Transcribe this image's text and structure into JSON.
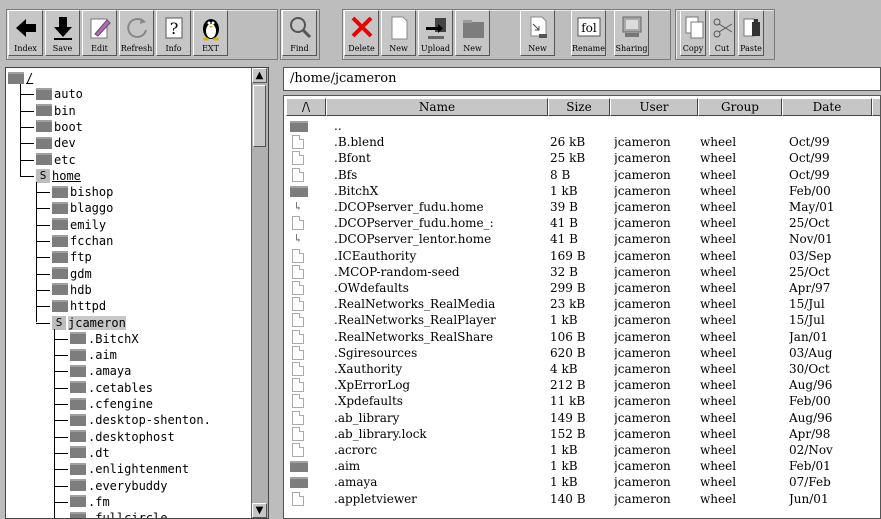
{
  "toolbar": {
    "buttons": [
      {
        "label": "Index"
      },
      {
        "label": "Save"
      },
      {
        "label": "Edit"
      },
      {
        "label": "Refresh"
      },
      {
        "label": "Info"
      },
      {
        "label": "EXT"
      },
      {
        "label": "Find"
      },
      {
        "label": "Delete"
      },
      {
        "label": "New"
      },
      {
        "label": "Upload"
      },
      {
        "label": "New"
      },
      {
        "label": "New"
      },
      {
        "label": "Rename"
      },
      {
        "label": "Sharing"
      },
      {
        "label": "Copy"
      },
      {
        "label": "Cut"
      },
      {
        "label": "Paste"
      }
    ]
  },
  "tree": {
    "root": "/",
    "items": [
      {
        "label": "auto"
      },
      {
        "label": "bin"
      },
      {
        "label": "boot"
      },
      {
        "label": "dev"
      },
      {
        "label": "etc"
      },
      {
        "label": "home",
        "badge": "S"
      },
      {
        "label": "bishop"
      },
      {
        "label": "blaggo"
      },
      {
        "label": "emily"
      },
      {
        "label": "fcchan"
      },
      {
        "label": "ftp"
      },
      {
        "label": "gdm"
      },
      {
        "label": "hdb"
      },
      {
        "label": "httpd"
      },
      {
        "label": "jcameron",
        "badge": "S"
      },
      {
        "label": ".BitchX"
      },
      {
        "label": ".aim"
      },
      {
        "label": ".amaya"
      },
      {
        "label": ".cetables"
      },
      {
        "label": ".cfengine"
      },
      {
        "label": ".desktop-shenton."
      },
      {
        "label": ".desktophost"
      },
      {
        "label": ".dt"
      },
      {
        "label": ".enlightenment"
      },
      {
        "label": ".everybuddy"
      },
      {
        "label": ".fm"
      },
      {
        "label": ".fullcircle"
      }
    ]
  },
  "path": "/home/jcameron",
  "columns": {
    "sort": "/\\",
    "name": "Name",
    "size": "Size",
    "user": "User",
    "group": "Group",
    "date": "Date"
  },
  "files": [
    {
      "type": "dir",
      "name": "..",
      "size": "",
      "user": "",
      "group": "",
      "date": ""
    },
    {
      "type": "doc",
      "name": ".B.blend",
      "size": "26 kB",
      "user": "jcameron",
      "group": "wheel",
      "date": "Oct/99"
    },
    {
      "type": "doc",
      "name": ".Bfont",
      "size": "25 kB",
      "user": "jcameron",
      "group": "wheel",
      "date": "Oct/99"
    },
    {
      "type": "doc",
      "name": ".Bfs",
      "size": "8 B",
      "user": "jcameron",
      "group": "wheel",
      "date": "Oct/99"
    },
    {
      "type": "dir",
      "name": ".BitchX",
      "size": "1 kB",
      "user": "jcameron",
      "group": "wheel",
      "date": "Feb/00"
    },
    {
      "type": "link",
      "name": ".DCOPserver_fudu.home",
      "size": "39 B",
      "user": "jcameron",
      "group": "wheel",
      "date": "May/01"
    },
    {
      "type": "doc",
      "name": ".DCOPserver_fudu.home_:",
      "size": "41 B",
      "user": "jcameron",
      "group": "wheel",
      "date": "25/Oct"
    },
    {
      "type": "link",
      "name": ".DCOPserver_lentor.home",
      "size": "41 B",
      "user": "jcameron",
      "group": "wheel",
      "date": "Nov/01"
    },
    {
      "type": "doc",
      "name": ".ICEauthority",
      "size": "169 B",
      "user": "jcameron",
      "group": "wheel",
      "date": "03/Sep"
    },
    {
      "type": "doc",
      "name": ".MCOP-random-seed",
      "size": "32 B",
      "user": "jcameron",
      "group": "wheel",
      "date": "25/Oct"
    },
    {
      "type": "doc",
      "name": ".OWdefaults",
      "size": "299 B",
      "user": "jcameron",
      "group": "wheel",
      "date": "Apr/97"
    },
    {
      "type": "doc",
      "name": ".RealNetworks_RealMedia",
      "size": "23 kB",
      "user": "jcameron",
      "group": "wheel",
      "date": "15/Jul"
    },
    {
      "type": "doc",
      "name": ".RealNetworks_RealPlayer",
      "size": "1 kB",
      "user": "jcameron",
      "group": "wheel",
      "date": "15/Jul"
    },
    {
      "type": "doc",
      "name": ".RealNetworks_RealShare",
      "size": "106 B",
      "user": "jcameron",
      "group": "wheel",
      "date": "Jan/01"
    },
    {
      "type": "doc",
      "name": ".Sgiresources",
      "size": "620 B",
      "user": "jcameron",
      "group": "wheel",
      "date": "03/Aug"
    },
    {
      "type": "doc",
      "name": ".Xauthority",
      "size": "4 kB",
      "user": "jcameron",
      "group": "wheel",
      "date": "30/Oct"
    },
    {
      "type": "doc",
      "name": ".XpErrorLog",
      "size": "212 B",
      "user": "jcameron",
      "group": "wheel",
      "date": "Aug/96"
    },
    {
      "type": "doc",
      "name": ".Xpdefaults",
      "size": "11 kB",
      "user": "jcameron",
      "group": "wheel",
      "date": "Feb/00"
    },
    {
      "type": "doc",
      "name": ".ab_library",
      "size": "149 B",
      "user": "jcameron",
      "group": "wheel",
      "date": "Aug/96"
    },
    {
      "type": "doc",
      "name": ".ab_library.lock",
      "size": "152 B",
      "user": "jcameron",
      "group": "wheel",
      "date": "Apr/98"
    },
    {
      "type": "doc",
      "name": ".acrorc",
      "size": "1 kB",
      "user": "jcameron",
      "group": "wheel",
      "date": "02/Nov"
    },
    {
      "type": "dir",
      "name": ".aim",
      "size": "1 kB",
      "user": "jcameron",
      "group": "wheel",
      "date": "Feb/01"
    },
    {
      "type": "dir",
      "name": ".amaya",
      "size": "1 kB",
      "user": "jcameron",
      "group": "wheel",
      "date": "07/Feb"
    },
    {
      "type": "doc",
      "name": ".appletviewer",
      "size": "140 B",
      "user": "jcameron",
      "group": "wheel",
      "date": "Jun/01"
    }
  ]
}
